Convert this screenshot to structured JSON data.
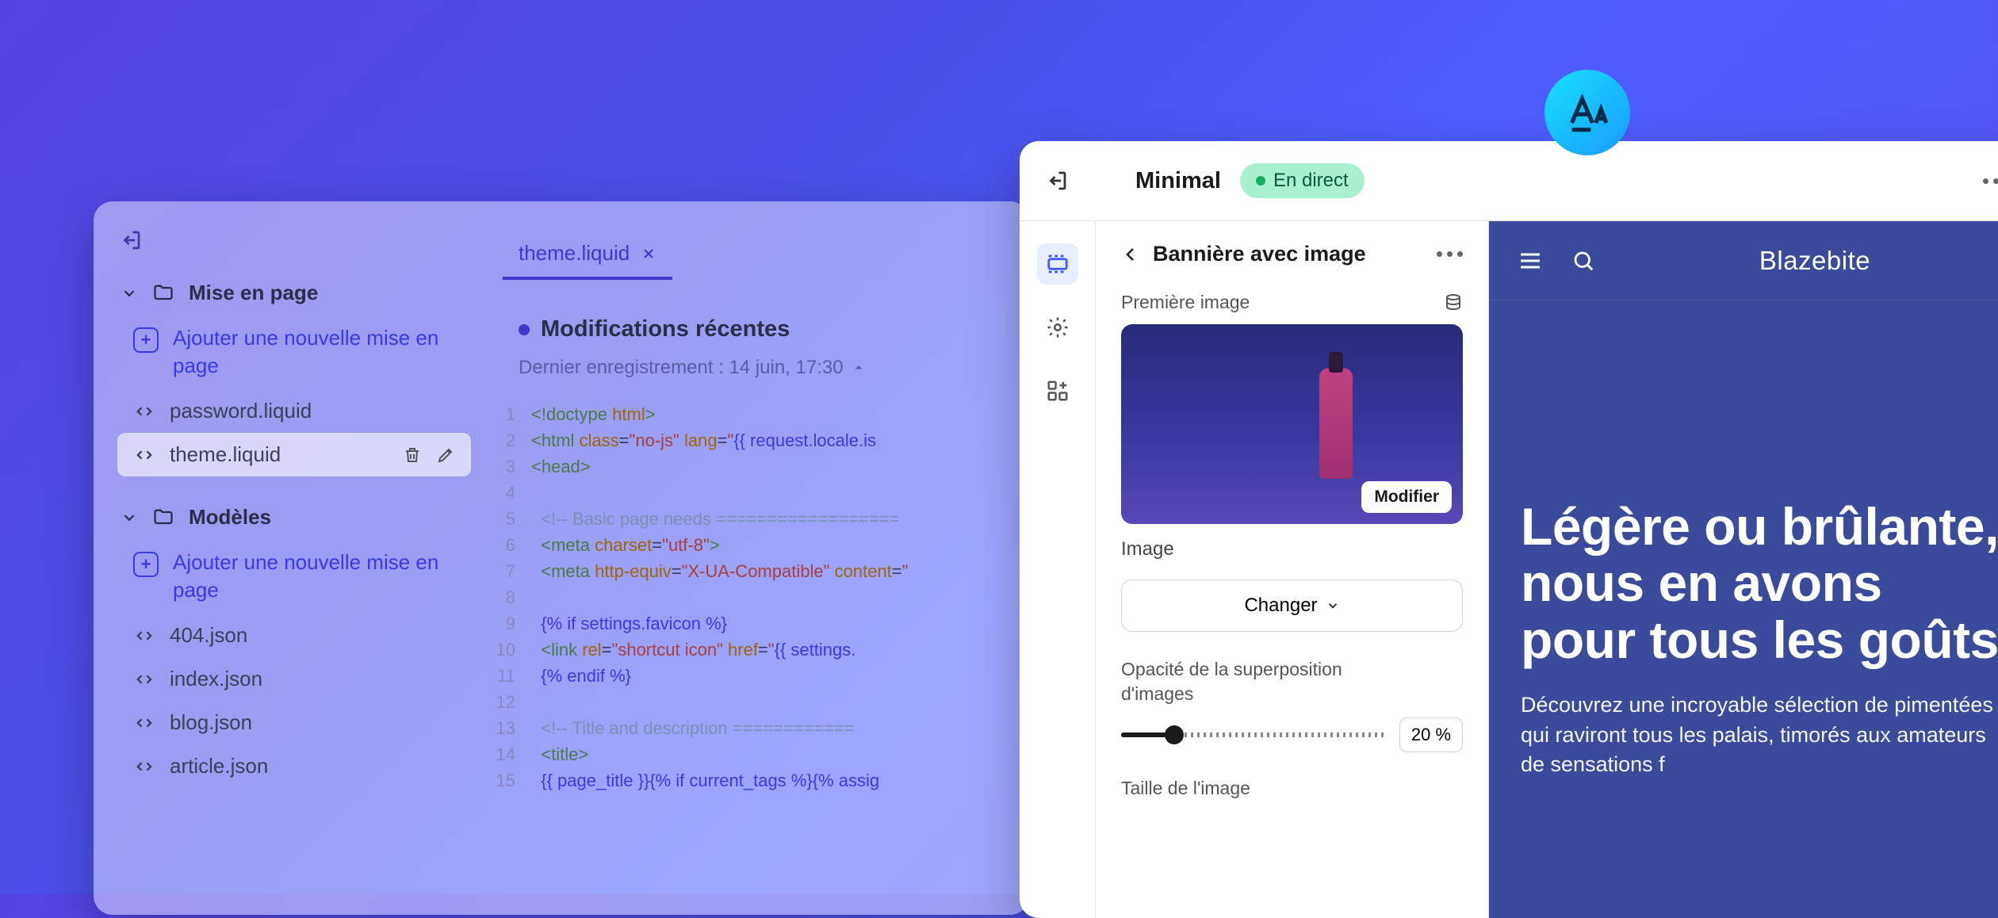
{
  "left_window": {
    "tree": {
      "section1": {
        "label": "Mise en page",
        "add": "Ajouter une nouvelle mise en page",
        "items": [
          {
            "name": "password.liquid",
            "active": false
          },
          {
            "name": "theme.liquid",
            "active": true
          }
        ]
      },
      "section2": {
        "label": "Modèles",
        "add": "Ajouter une nouvelle mise en page",
        "items": [
          {
            "name": "404.json"
          },
          {
            "name": "index.json"
          },
          {
            "name": "blog.json"
          },
          {
            "name": "article.json"
          }
        ]
      }
    },
    "tab": "theme.liquid",
    "recent": {
      "title": "Modifications récentes",
      "subtitle": "Dernier enregistrement : 14 juin, 17:30"
    },
    "code_lines": [
      {
        "n": 1,
        "h": "<span class='c-tag'>&lt;!doctype</span> <span class='c-attr'>html</span><span class='c-tag'>&gt;</span>"
      },
      {
        "n": 2,
        "h": "<span class='c-tag'>&lt;html</span> <span class='c-attr'>class</span>=<span class='c-str'>\"no-js\"</span> <span class='c-attr'>lang</span>=<span class='c-str'>\"</span><span class='c-lq'>{{ request.locale.is</span>"
      },
      {
        "n": 3,
        "h": "<span class='c-tag'>&lt;head&gt;</span>"
      },
      {
        "n": 4,
        "h": ""
      },
      {
        "n": 5,
        "h": "  <span class='c-cm'>&lt;!-- Basic page needs ==================</span>"
      },
      {
        "n": 6,
        "h": "  <span class='c-tag'>&lt;meta</span> <span class='c-attr'>charset</span>=<span class='c-str'>\"utf-8\"</span><span class='c-tag'>&gt;</span>"
      },
      {
        "n": 7,
        "h": "  <span class='c-tag'>&lt;meta</span> <span class='c-attr'>http-equiv</span>=<span class='c-str'>\"X-UA-Compatible\"</span> <span class='c-attr'>content</span>=<span class='c-str'>\"</span>"
      },
      {
        "n": 8,
        "h": ""
      },
      {
        "n": 9,
        "h": "  <span class='c-lq'>{% if settings.favicon %}</span>"
      },
      {
        "n": 10,
        "h": "  <span class='c-tag'>&lt;link</span> <span class='c-attr'>rel</span>=<span class='c-str'>\"shortcut icon\"</span> <span class='c-attr'>href</span>=<span class='c-str'>\"</span><span class='c-lq'>{{ settings.</span>"
      },
      {
        "n": 11,
        "h": "  <span class='c-lq'>{% endif %}</span>"
      },
      {
        "n": 12,
        "h": ""
      },
      {
        "n": 13,
        "h": "  <span class='c-cm'>&lt;!-- Title and description ============</span>"
      },
      {
        "n": 14,
        "h": "  <span class='c-tag'>&lt;title&gt;</span>"
      },
      {
        "n": 15,
        "h": "  <span class='c-lq'>{{ page_title }}{% if current_tags %}{% assig</span>"
      }
    ]
  },
  "right_window": {
    "title": "Minimal",
    "badge": "En direct",
    "panel": {
      "title": "Bannière avec image",
      "first_image_label": "Première image",
      "modify_btn": "Modifier",
      "image_caption": "Image",
      "change_btn": "Changer",
      "opacity_label": "Opacité de la superposition d'images",
      "opacity_value": "20",
      "opacity_unit": "%",
      "size_label": "Taille de l'image"
    },
    "preview": {
      "brand": "Blazebite",
      "headline": "Légère ou brûlante, nous en avons pour tous les goûts",
      "sub": "Découvrez une incroyable sélection de pimentées qui raviront tous les palais, timorés aux amateurs de sensations f"
    }
  },
  "icons": {
    "chevron_down": "▾"
  }
}
